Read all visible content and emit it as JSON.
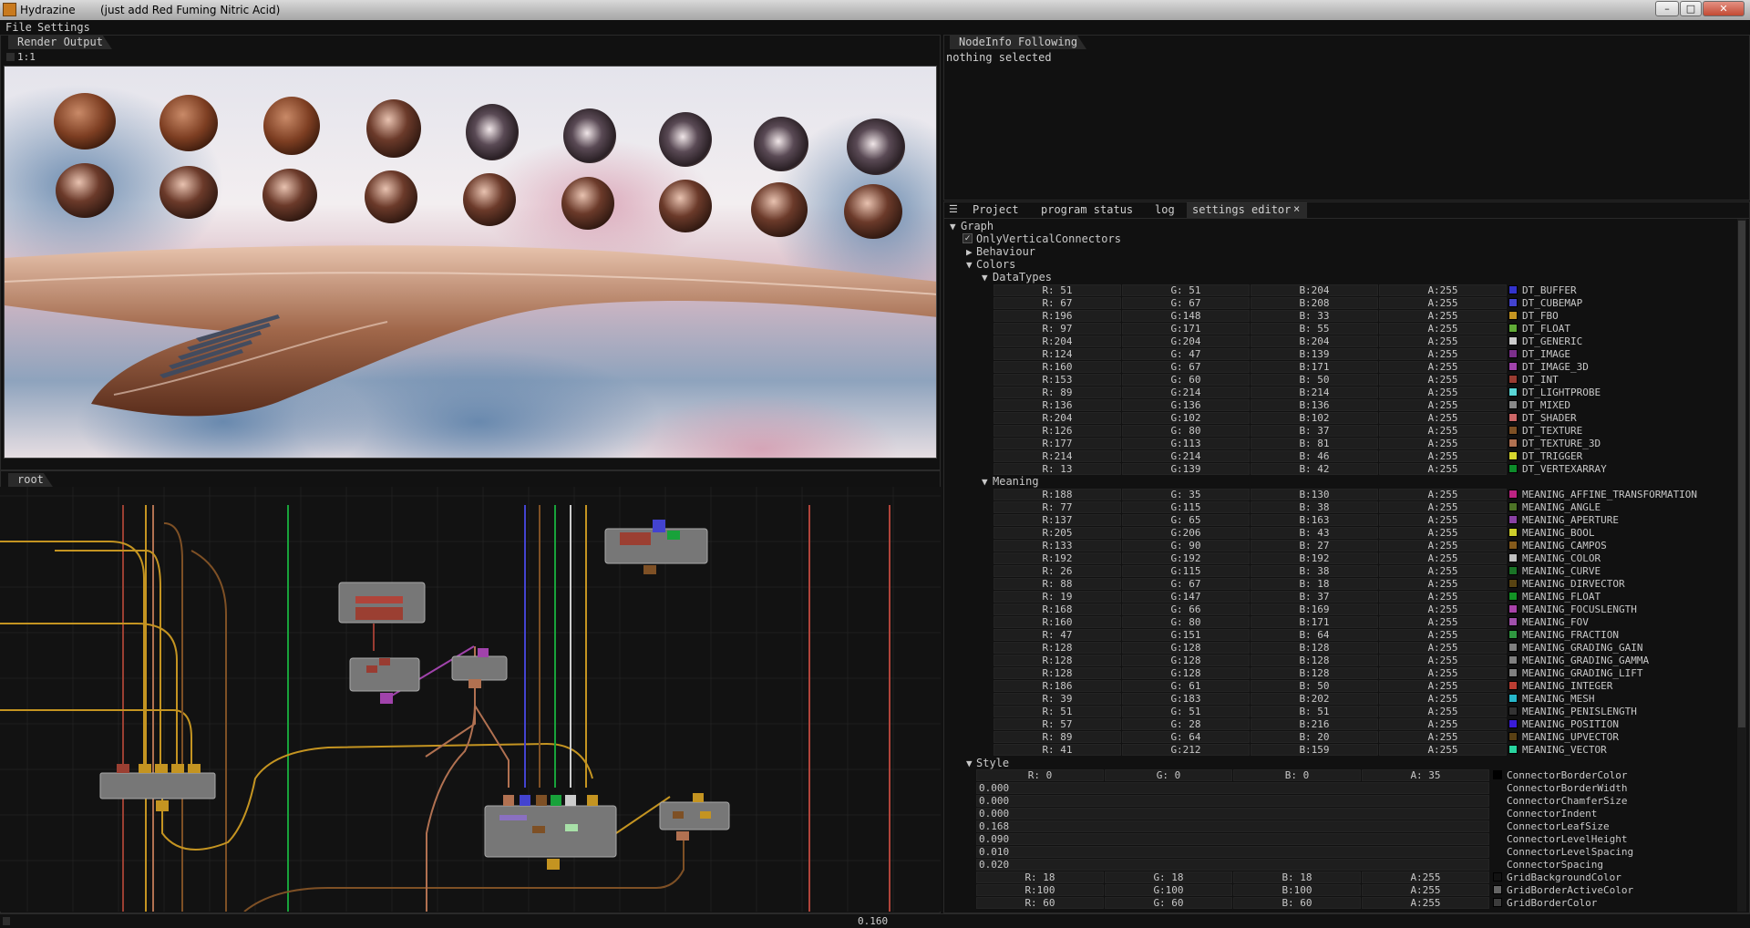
{
  "window": {
    "app_name": "Hydrazine",
    "subtitle": "(just add Red Fuming Nitric Acid)",
    "minimize_glyph": "–",
    "maximize_glyph": "□",
    "close_glyph": "✕"
  },
  "menu": {
    "file": "File",
    "settings": "Settings"
  },
  "render_panel": {
    "tab": "Render Output",
    "zoom_label": "1:1"
  },
  "graph_panel": {
    "tab": "root"
  },
  "nodeinfo_panel": {
    "tab": "NodeInfo Following",
    "message": "nothing selected"
  },
  "bottom_tabs": {
    "project": "Project",
    "program_status": "program status",
    "log": "log",
    "settings_editor": "settings editor",
    "close_glyph": "×"
  },
  "tree": {
    "graph": "Graph",
    "only_vertical": "OnlyVerticalConnectors",
    "behaviour": "Behaviour",
    "colors": "Colors",
    "datatypes": "DataTypes",
    "meaning": "Meaning",
    "style": "Style"
  },
  "datatypes": [
    {
      "r": "R: 51",
      "g": "G: 51",
      "b": "B:204",
      "a": "A:255",
      "name": "DT_BUFFER",
      "color": "#3333cc"
    },
    {
      "r": "R: 67",
      "g": "G: 67",
      "b": "B:208",
      "a": "A:255",
      "name": "DT_CUBEMAP",
      "color": "#4343d0"
    },
    {
      "r": "R:196",
      "g": "G:148",
      "b": "B: 33",
      "a": "A:255",
      "name": "DT_FBO",
      "color": "#c49421"
    },
    {
      "r": "R: 97",
      "g": "G:171",
      "b": "B: 55",
      "a": "A:255",
      "name": "DT_FLOAT",
      "color": "#61ab37"
    },
    {
      "r": "R:204",
      "g": "G:204",
      "b": "B:204",
      "a": "A:255",
      "name": "DT_GENERIC",
      "color": "#cccccc"
    },
    {
      "r": "R:124",
      "g": "G: 47",
      "b": "B:139",
      "a": "A:255",
      "name": "DT_IMAGE",
      "color": "#7c2f8b"
    },
    {
      "r": "R:160",
      "g": "G: 67",
      "b": "B:171",
      "a": "A:255",
      "name": "DT_IMAGE_3D",
      "color": "#a043ab"
    },
    {
      "r": "R:153",
      "g": "G: 60",
      "b": "B: 50",
      "a": "A:255",
      "name": "DT_INT",
      "color": "#993c32"
    },
    {
      "r": "R: 89",
      "g": "G:214",
      "b": "B:214",
      "a": "A:255",
      "name": "DT_LIGHTPROBE",
      "color": "#59d6d6"
    },
    {
      "r": "R:136",
      "g": "G:136",
      "b": "B:136",
      "a": "A:255",
      "name": "DT_MIXED",
      "color": "#888888"
    },
    {
      "r": "R:204",
      "g": "G:102",
      "b": "B:102",
      "a": "A:255",
      "name": "DT_SHADER",
      "color": "#cc6666"
    },
    {
      "r": "R:126",
      "g": "G: 80",
      "b": "B: 37",
      "a": "A:255",
      "name": "DT_TEXTURE",
      "color": "#7e5025"
    },
    {
      "r": "R:177",
      "g": "G:113",
      "b": "B: 81",
      "a": "A:255",
      "name": "DT_TEXTURE_3D",
      "color": "#b17151"
    },
    {
      "r": "R:214",
      "g": "G:214",
      "b": "B: 46",
      "a": "A:255",
      "name": "DT_TRIGGER",
      "color": "#d6d62e"
    },
    {
      "r": "R: 13",
      "g": "G:139",
      "b": "B: 42",
      "a": "A:255",
      "name": "DT_VERTEXARRAY",
      "color": "#0d8b2a"
    }
  ],
  "meanings": [
    {
      "r": "R:188",
      "g": "G: 35",
      "b": "B:130",
      "a": "A:255",
      "name": "MEANING_AFFINE_TRANSFORMATION",
      "color": "#bc2382"
    },
    {
      "r": "R: 77",
      "g": "G:115",
      "b": "B: 38",
      "a": "A:255",
      "name": "MEANING_ANGLE",
      "color": "#4d7326"
    },
    {
      "r": "R:137",
      "g": "G: 65",
      "b": "B:163",
      "a": "A:255",
      "name": "MEANING_APERTURE",
      "color": "#8941a3"
    },
    {
      "r": "R:205",
      "g": "G:206",
      "b": "B: 43",
      "a": "A:255",
      "name": "MEANING_BOOL",
      "color": "#cdce2b"
    },
    {
      "r": "R:133",
      "g": "G: 90",
      "b": "B: 27",
      "a": "A:255",
      "name": "MEANING_CAMPOS",
      "color": "#855a1b"
    },
    {
      "r": "R:192",
      "g": "G:192",
      "b": "B:192",
      "a": "A:255",
      "name": "MEANING_COLOR",
      "color": "#c0c0c0"
    },
    {
      "r": "R: 26",
      "g": "G:115",
      "b": "B: 38",
      "a": "A:255",
      "name": "MEANING_CURVE",
      "color": "#1a7326"
    },
    {
      "r": "R: 88",
      "g": "G: 67",
      "b": "B: 18",
      "a": "A:255",
      "name": "MEANING_DIRVECTOR",
      "color": "#584312"
    },
    {
      "r": "R: 19",
      "g": "G:147",
      "b": "B: 37",
      "a": "A:255",
      "name": "MEANING_FLOAT",
      "color": "#139325"
    },
    {
      "r": "R:168",
      "g": "G: 66",
      "b": "B:169",
      "a": "A:255",
      "name": "MEANING_FOCUSLENGTH",
      "color": "#a842a9"
    },
    {
      "r": "R:160",
      "g": "G: 80",
      "b": "B:171",
      "a": "A:255",
      "name": "MEANING_FOV",
      "color": "#a050ab"
    },
    {
      "r": "R: 47",
      "g": "G:151",
      "b": "B: 64",
      "a": "A:255",
      "name": "MEANING_FRACTION",
      "color": "#2f9740"
    },
    {
      "r": "R:128",
      "g": "G:128",
      "b": "B:128",
      "a": "A:255",
      "name": "MEANING_GRADING_GAIN",
      "color": "#808080"
    },
    {
      "r": "R:128",
      "g": "G:128",
      "b": "B:128",
      "a": "A:255",
      "name": "MEANING_GRADING_GAMMA",
      "color": "#808080"
    },
    {
      "r": "R:128",
      "g": "G:128",
      "b": "B:128",
      "a": "A:255",
      "name": "MEANING_GRADING_LIFT",
      "color": "#808080"
    },
    {
      "r": "R:186",
      "g": "G: 61",
      "b": "B: 50",
      "a": "A:255",
      "name": "MEANING_INTEGER",
      "color": "#ba3d32"
    },
    {
      "r": "R: 39",
      "g": "G:183",
      "b": "B:202",
      "a": "A:255",
      "name": "MEANING_MESH",
      "color": "#27b7ca"
    },
    {
      "r": "R: 51",
      "g": "G: 51",
      "b": "B: 51",
      "a": "A:255",
      "name": "MEANING_PENISLENGTH",
      "color": "#333333"
    },
    {
      "r": "R: 57",
      "g": "G: 28",
      "b": "B:216",
      "a": "A:255",
      "name": "MEANING_POSITION",
      "color": "#391cd8"
    },
    {
      "r": "R: 89",
      "g": "G: 64",
      "b": "B: 20",
      "a": "A:255",
      "name": "MEANING_UPVECTOR",
      "color": "#594014"
    },
    {
      "r": "R: 41",
      "g": "G:212",
      "b": "B:159",
      "a": "A:255",
      "name": "MEANING_VECTOR",
      "color": "#29d49f"
    }
  ],
  "style": {
    "connector_border_color": {
      "r": "R: 0",
      "g": "G: 0",
      "b": "B: 0",
      "a": "A: 35",
      "name": "ConnectorBorderColor",
      "color": "#000000"
    },
    "scalars": [
      {
        "value": "0.000",
        "name": "ConnectorBorderWidth"
      },
      {
        "value": "0.000",
        "name": "ConnectorChamferSize"
      },
      {
        "value": "0.000",
        "name": "ConnectorIndent"
      },
      {
        "value": "0.168",
        "name": "ConnectorLeafSize"
      },
      {
        "value": "0.090",
        "name": "ConnectorLevelHeight"
      },
      {
        "value": "0.010",
        "name": "ConnectorLevelSpacing"
      },
      {
        "value": "0.020",
        "name": "ConnectorSpacing"
      }
    ],
    "colors": [
      {
        "r": "R: 18",
        "g": "G: 18",
        "b": "B: 18",
        "a": "A:255",
        "name": "GridBackgroundColor",
        "color": "#121212"
      },
      {
        "r": "R:100",
        "g": "G:100",
        "b": "B:100",
        "a": "A:255",
        "name": "GridBorderActiveColor",
        "color": "#646464"
      },
      {
        "r": "R: 60",
        "g": "G: 60",
        "b": "B: 60",
        "a": "A:255",
        "name": "GridBorderColor",
        "color": "#3c3c3c"
      }
    ]
  },
  "status": {
    "value": "0.160"
  }
}
